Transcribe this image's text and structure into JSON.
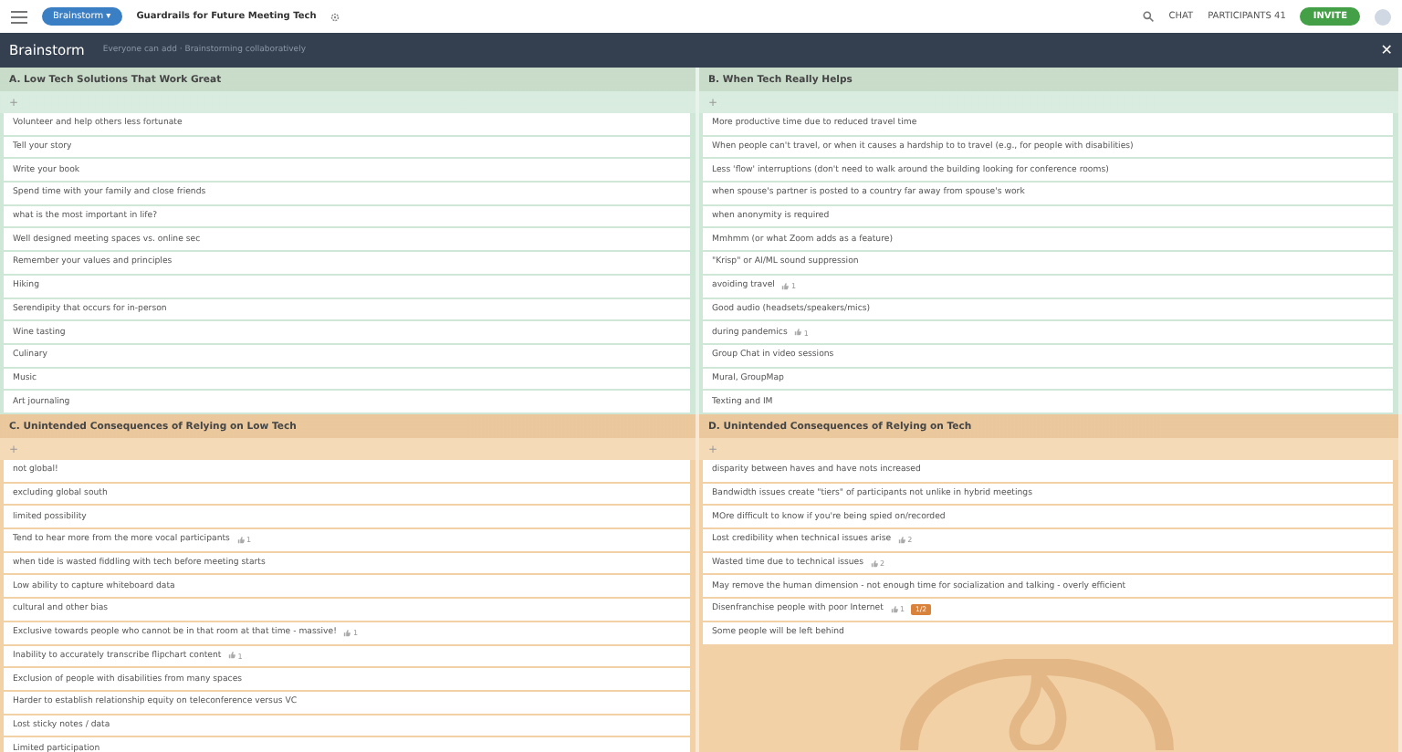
{
  "top_bar": {
    "mode": "Brainstorm",
    "mode_caret": "▾",
    "title": "Guardrails for Future Meeting Tech",
    "chat": "CHAT",
    "participants": "PARTICIPANTS",
    "participant_count": "41",
    "invite": "INVITE"
  },
  "activity_bar": {
    "title": "Brainstorm",
    "subtitle": "Everyone can add · Brainstorming collaboratively",
    "close": "✕"
  },
  "sections": [
    {
      "title": "A. Low Tech Solutions That Work Great",
      "color": "#cfe7d7",
      "add": "+",
      "items": [
        {
          "text": "Volunteer and help others less fortunate"
        },
        {
          "text": "Tell your story"
        },
        {
          "text": "Write your book"
        },
        {
          "text": "Spend time with your family and close friends"
        },
        {
          "text": "what is the most important in life?"
        },
        {
          "text": "Well designed meeting spaces vs. online sec"
        },
        {
          "text": "Remember your values and principles"
        },
        {
          "text": "Hiking"
        },
        {
          "text": "Serendipity that occurs for in-person"
        },
        {
          "text": "Wine tasting"
        },
        {
          "text": "Culinary"
        },
        {
          "text": "Music"
        },
        {
          "text": "Art journaling"
        }
      ]
    },
    {
      "title": "B. When Tech Really Helps",
      "color": "#cfe7d7",
      "add": "+",
      "items": [
        {
          "text": "More productive time due to reduced travel time"
        },
        {
          "text": "When people can't travel, or when it causes a hardship to to travel (e.g., for people with disabilities)"
        },
        {
          "text": "Less 'flow' interruptions (don't need to walk around the building looking for conference rooms)"
        },
        {
          "text": "when spouse's partner is posted to a country far away from spouse's work"
        },
        {
          "text": "when anonymity is required"
        },
        {
          "text": "Mmhmm (or what Zoom adds as a feature)"
        },
        {
          "text": "\"Krisp\" or AI/ML sound suppression"
        },
        {
          "text": "avoiding travel",
          "votes": "1"
        },
        {
          "text": "Good audio (headsets/speakers/mics)"
        },
        {
          "text": "during pandemics",
          "votes": "1"
        },
        {
          "text": "Group Chat in video sessions"
        },
        {
          "text": "Mural, GroupMap"
        },
        {
          "text": "Texting and IM"
        }
      ]
    },
    {
      "title": "C. Unintended Consequences of Relying on Low Tech",
      "color": "#f3d1a6",
      "add": "+",
      "items": [
        {
          "text": "not global!"
        },
        {
          "text": "excluding global south"
        },
        {
          "text": "limited possibility"
        },
        {
          "text": "Tend to hear more from the more vocal participants",
          "votes": "1"
        },
        {
          "text": "when tide is wasted fiddling with tech before meeting starts"
        },
        {
          "text": "Low ability to capture whiteboard data"
        },
        {
          "text": "cultural and other bias"
        },
        {
          "text": "Exclusive towards people who cannot be in that room at that time - massive!",
          "votes": "1"
        },
        {
          "text": "Inability to accurately transcribe flipchart content",
          "votes": "1"
        },
        {
          "text": "Exclusion of people with disabilities from many spaces"
        },
        {
          "text": "Harder to establish relationship equity on teleconference versus VC"
        },
        {
          "text": "Lost sticky notes / data"
        },
        {
          "text": "Limited participation"
        }
      ]
    },
    {
      "title": "D. Unintended Consequences of Relying on Tech",
      "color": "#f3d1a6",
      "add": "+",
      "items": [
        {
          "text": "disparity between haves and have nots increased"
        },
        {
          "text": "Bandwidth issues create \"tiers\" of participants not unlike in hybrid meetings"
        },
        {
          "text": "MOre difficult to know if you're being spied on/recorded"
        },
        {
          "text": "Lost credibility when technical issues arise",
          "votes": "2"
        },
        {
          "text": "Wasted time due to technical issues",
          "votes": "2"
        },
        {
          "text": "May remove the human dimension - not enough time for socialization and talking - overly efficient"
        },
        {
          "text": "Disenfranchise people with poor Internet",
          "votes": "1",
          "badge": "1/2"
        },
        {
          "text": "Some people will be left behind"
        }
      ]
    }
  ]
}
